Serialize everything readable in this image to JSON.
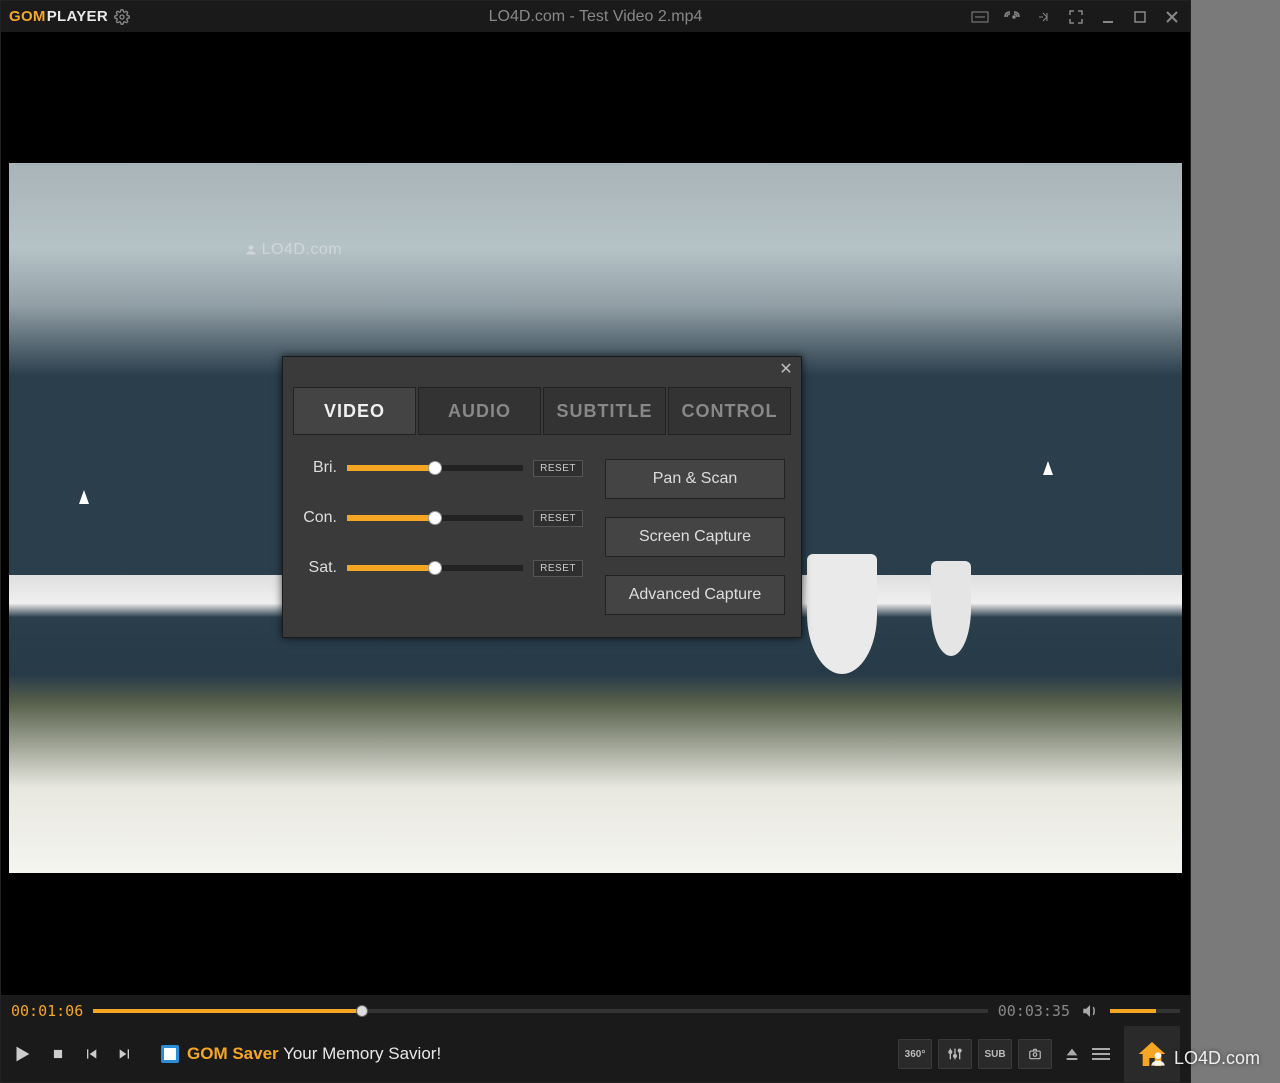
{
  "titlebar": {
    "logo_gom": "GOM",
    "logo_player": "PLAYER",
    "title": "LO4D.com - Test Video 2.mp4"
  },
  "watermark": {
    "center": "LO4D.com",
    "top": "LO4D.com",
    "external": "LO4D.com"
  },
  "popup": {
    "tabs": {
      "video": "VIDEO",
      "audio": "AUDIO",
      "subtitle": "SUBTITLE",
      "control": "CONTROL"
    },
    "sliders": {
      "bri": {
        "label": "Bri.",
        "value_pct": 50,
        "reset": "RESET"
      },
      "con": {
        "label": "Con.",
        "value_pct": 50,
        "reset": "RESET"
      },
      "sat": {
        "label": "Sat.",
        "value_pct": 50,
        "reset": "RESET"
      }
    },
    "buttons": {
      "panscan": "Pan & Scan",
      "capture": "Screen Capture",
      "adv": "Advanced Capture"
    }
  },
  "progress": {
    "elapsed": "00:01:06",
    "total": "00:03:35",
    "percent": 30,
    "volume_pct": 65
  },
  "controlbar": {
    "marquee_prefix": "GOM Saver",
    "marquee_rest": " Your Memory Savior!",
    "tool_360": "360°",
    "tool_sub": "SUB"
  }
}
